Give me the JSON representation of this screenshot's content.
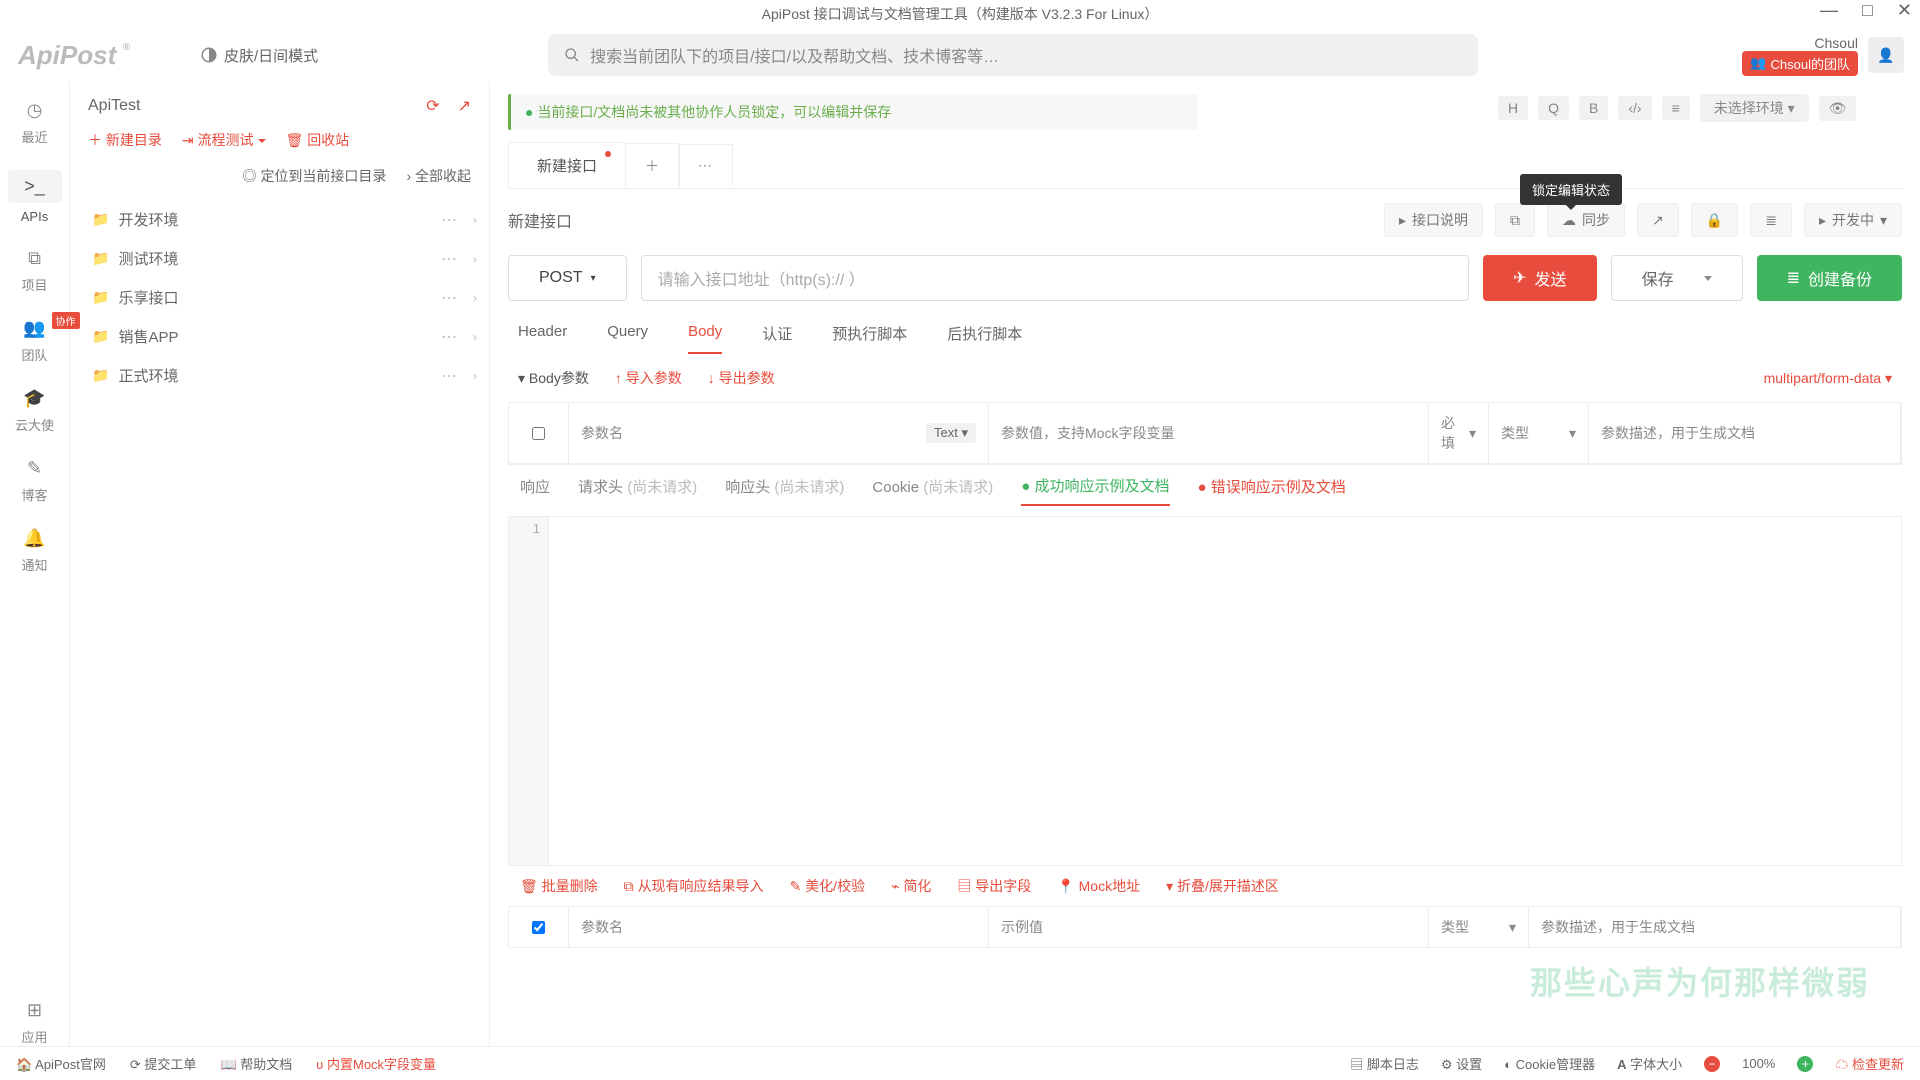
{
  "app": {
    "title": "ApiPost 接口调试与文档管理工具（构建版本 V3.2.3 For Linux）"
  },
  "header": {
    "logo": "ApiPost",
    "skin": "皮肤/日间模式",
    "search_placeholder": "搜索当前团队下的项目/接口/以及帮助文档、技术博客等…",
    "username": "Chsoul",
    "team_badge": "Chsoul的团队"
  },
  "leftrail": {
    "items": [
      {
        "icon": "◷",
        "label": "最近"
      },
      {
        "icon": ">_",
        "label": "APIs",
        "active": true
      },
      {
        "icon": "⧉",
        "label": "项目"
      },
      {
        "icon": "👥",
        "label": "团队",
        "badge": true
      },
      {
        "icon": "🎓",
        "label": "云大使"
      },
      {
        "icon": "✎",
        "label": "博客"
      },
      {
        "icon": "🔔",
        "label": "通知"
      }
    ],
    "bottom": {
      "icon": "⊞",
      "label": "应用"
    }
  },
  "sidebar": {
    "project": "ApiTest",
    "new_dir": "新建目录",
    "flow": "流程测试",
    "recycle": "回收站",
    "locate": "定位到当前接口目录",
    "collapse": "全部收起",
    "folders": [
      "开发环境",
      "测试环境",
      "乐享接口",
      "销售APP",
      "正式环境"
    ]
  },
  "content": {
    "alert": "当前接口/文档尚未被其他协作人员锁定，可以编辑并保存",
    "headertools": {
      "H": "H",
      "Q": "Q",
      "B": "B",
      "env": "未选择环境"
    },
    "tab": "新建接口",
    "tooltip": "锁定编辑状态",
    "row2": {
      "name": "新建接口",
      "desc": "接口说明",
      "sync": "同步",
      "status": "开发中"
    },
    "req": {
      "method": "POST",
      "url_placeholder": "请输入接口地址（http(s):// ）",
      "send": "发送",
      "save": "保存",
      "backup": "创建备份"
    },
    "subtabs": [
      "Header",
      "Query",
      "Body",
      "认证",
      "预执行脚本",
      "后执行脚本"
    ],
    "bodyhdr": {
      "title": "Body参数",
      "imp": "导入参数",
      "exp": "导出参数",
      "fmt": "multipart/form-data"
    },
    "grid": {
      "c1": "参数名",
      "ctext": "Text",
      "c2": "参数值，支持Mock字段变量",
      "c3": "必填",
      "c4": "类型",
      "c5": "参数描述，用于生成文档"
    },
    "resptabs": {
      "r1": "响应",
      "r2a": "请求头",
      "r2b": "(尚未请求)",
      "r3a": "响应头",
      "r3b": "(尚未请求)",
      "r4a": "Cookie",
      "r4b": "(尚未请求)",
      "r5": "成功响应示例及文档",
      "r6": "错误响应示例及文档"
    },
    "gutter": "1",
    "ops": [
      "批量删除",
      "从现有响应结果导入",
      "美化/校验",
      "简化",
      "导出字段",
      "Mock地址",
      "折叠/展开描述区"
    ],
    "grid2": {
      "c1": "参数名",
      "c2": "示例值",
      "c4": "类型",
      "c5": "参数描述，用于生成文档"
    }
  },
  "footer": {
    "l": [
      "ApiPost官网",
      "提交工单",
      "帮助文档",
      "内置Mock字段变量"
    ],
    "r": {
      "log": "脚本日志",
      "set": "设置",
      "cookie": "Cookie管理器",
      "font": "字体大小",
      "zoom": "100%",
      "upd": "检查更新"
    }
  },
  "watermark": "那些心声为何那样微弱"
}
